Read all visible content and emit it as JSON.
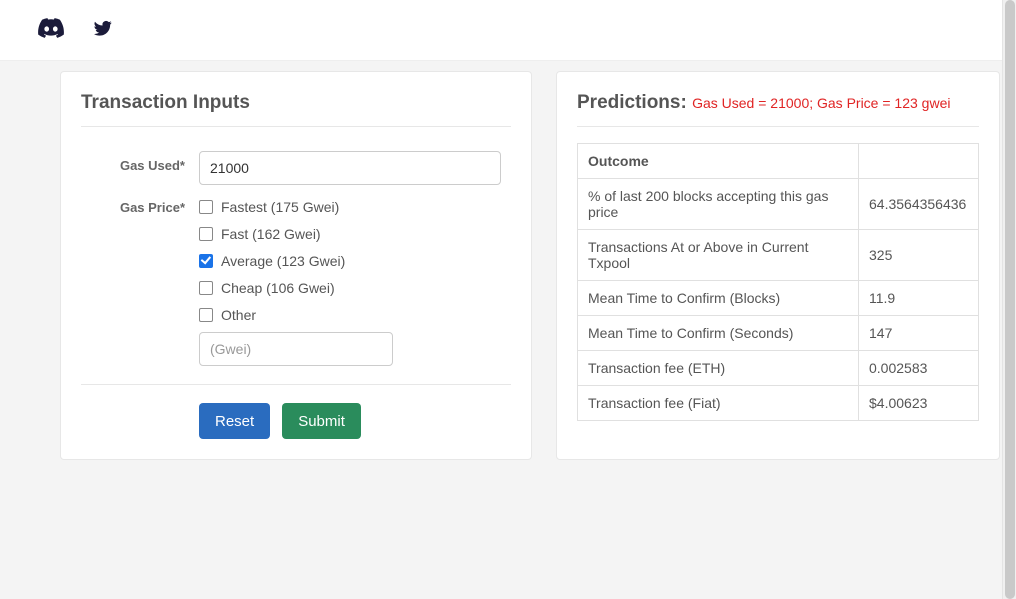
{
  "header": {
    "icons": [
      "discord",
      "twitter"
    ]
  },
  "left": {
    "title": "Transaction Inputs",
    "form": {
      "gas_used": {
        "label": "Gas Used*",
        "value": "21000"
      },
      "gas_price": {
        "label": "Gas Price*",
        "options": [
          {
            "label": "Fastest (175 Gwei)",
            "checked": false
          },
          {
            "label": "Fast (162 Gwei)",
            "checked": false
          },
          {
            "label": "Average (123 Gwei)",
            "checked": true
          },
          {
            "label": "Cheap (106 Gwei)",
            "checked": false
          },
          {
            "label": "Other",
            "checked": false
          }
        ],
        "other_placeholder": "(Gwei)"
      }
    },
    "buttons": {
      "reset": "Reset",
      "submit": "Submit"
    }
  },
  "right": {
    "title": "Predictions:",
    "subtitle": "Gas Used = 21000; Gas Price = 123 gwei",
    "table": {
      "header": "Outcome",
      "rows": [
        {
          "name": "% of last 200 blocks accepting this gas price",
          "value": "64.3564356436"
        },
        {
          "name": "Transactions At or Above in Current Txpool",
          "value": "325"
        },
        {
          "name": "Mean Time to Confirm (Blocks)",
          "value": "11.9"
        },
        {
          "name": "Mean Time to Confirm (Seconds)",
          "value": "147"
        },
        {
          "name": "Transaction fee (ETH)",
          "value": "0.002583"
        },
        {
          "name": "Transaction fee (Fiat)",
          "value": "$4.00623"
        }
      ]
    }
  }
}
